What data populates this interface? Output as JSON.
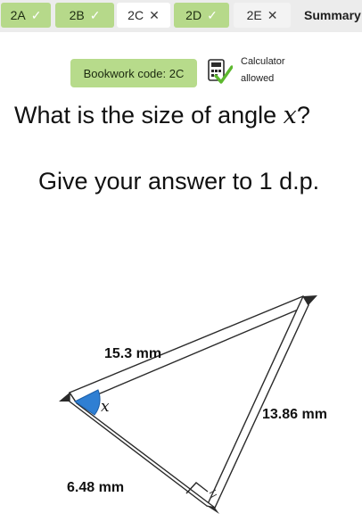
{
  "tabs": [
    {
      "label": "2A",
      "status": "correct",
      "mark": "✓"
    },
    {
      "label": "2B",
      "status": "correct",
      "mark": "✓"
    },
    {
      "label": "2C",
      "status": "wrong",
      "mark": "✕"
    },
    {
      "label": "2D",
      "status": "correct",
      "mark": "✓"
    },
    {
      "label": "2E",
      "status": "wrong",
      "mark": "✕"
    },
    {
      "label": "Summary",
      "status": "summary"
    }
  ],
  "bookwork": {
    "label": "Bookwork code: 2C"
  },
  "calculator": {
    "line1": "Calculator",
    "line2": "allowed",
    "icon": "calculator-icon"
  },
  "question": {
    "prefix": "What is the size of angle ",
    "variable": "x",
    "suffix": "?"
  },
  "instruction": "Give your answer to 1 d.p.",
  "diagram": {
    "hypotenuse_label": "15.3 mm",
    "opposite_label": "13.86 mm",
    "adjacent_label": "6.48 mm",
    "angle_label": "x"
  },
  "colors": {
    "correct_tab": "#b6d98a",
    "wrong_tab": "#ffffff",
    "tabbar": "#ececec",
    "bookwork": "#b7db8b",
    "angle_fill": "#2f7fd3"
  }
}
